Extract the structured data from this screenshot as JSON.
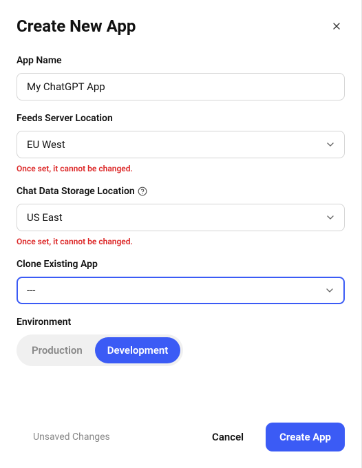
{
  "modal": {
    "title": "Create New App"
  },
  "form": {
    "app_name": {
      "label": "App Name",
      "value": "My ChatGPT App"
    },
    "feeds_location": {
      "label": "Feeds Server Location",
      "value": "EU West",
      "warning": "Once set, it cannot be changed."
    },
    "chat_storage": {
      "label": "Chat Data Storage Location",
      "value": "US East",
      "warning": "Once set, it cannot be changed."
    },
    "clone": {
      "label": "Clone Existing App",
      "value": "---"
    },
    "environment": {
      "label": "Environment",
      "options": {
        "production": "Production",
        "development": "Development"
      },
      "selected": "development"
    }
  },
  "footer": {
    "unsaved": "Unsaved Changes",
    "cancel": "Cancel",
    "create": "Create App"
  }
}
